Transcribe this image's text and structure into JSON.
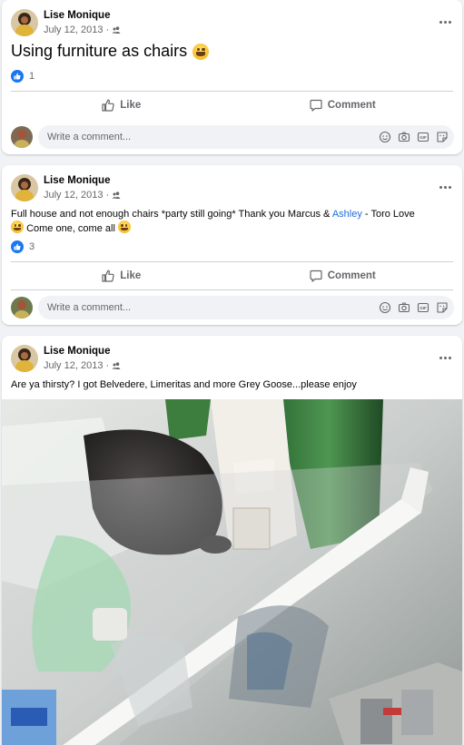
{
  "posts": [
    {
      "author": "Lise Monique",
      "date": "July 12, 2013",
      "audience_icon": "friends-icon",
      "text": "Using furniture as chairs",
      "reaction_count": "1",
      "actions": {
        "like": "Like",
        "comment": "Comment"
      },
      "comment_placeholder": "Write a comment..."
    },
    {
      "author": "Lise Monique",
      "date": "July 12, 2013",
      "audience_icon": "friends-icon",
      "text_part1": "Full house and not enough chairs *party still going* Thank you Marcus & ",
      "mention": "Ashley",
      "text_part2": " - Toro Love",
      "text_line2": "Come one, come all",
      "reaction_count": "3",
      "actions": {
        "like": "Like",
        "comment": "Comment"
      },
      "comment_placeholder": "Write a comment..."
    },
    {
      "author": "Lise Monique",
      "date": "July 12, 2013",
      "audience_icon": "friends-icon",
      "text": "Are ya thirsty? I got Belvedere, Limeritas and more Grey Goose...please enjoy"
    }
  ],
  "date_separator": "·",
  "colors": {
    "like_blue": "#1877f2",
    "mention_blue": "#216fdb",
    "secondary_text": "#65676b"
  }
}
